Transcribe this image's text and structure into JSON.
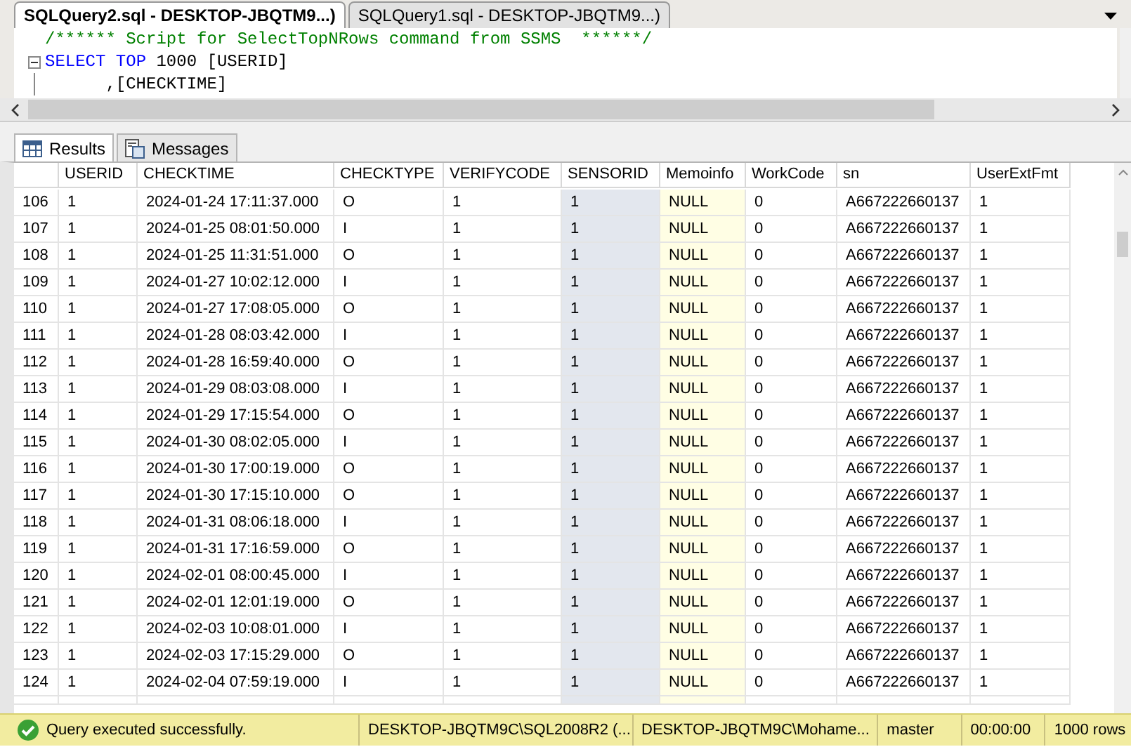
{
  "editor_tabs": [
    {
      "label": "SQLQuery2.sql - DESKTOP-JBQTM9...)",
      "selected": true
    },
    {
      "label": "SQLQuery1.sql - DESKTOP-JBQTM9...)",
      "selected": false
    }
  ],
  "editor": {
    "lines": [
      {
        "tokens": [
          {
            "kind": "comment",
            "text": "/****** Script for SelectTopNRows command from SSMS  ******/"
          }
        ]
      },
      {
        "collapsible": true,
        "tokens": [
          {
            "kind": "keyword",
            "text": "SELECT"
          },
          {
            "kind": "keyword",
            "text": " TOP"
          },
          {
            "kind": "plain",
            "text": " 1000 [USERID]"
          }
        ]
      },
      {
        "tokens": [
          {
            "kind": "plain",
            "text": "      ,[CHECKTIME]"
          }
        ]
      }
    ]
  },
  "result_tabs": [
    {
      "label": "Results",
      "selected": true
    },
    {
      "label": "Messages",
      "selected": false
    }
  ],
  "grid": {
    "columns": [
      {
        "label": "USERID",
        "kind": "text"
      },
      {
        "label": "CHECKTIME",
        "kind": "text"
      },
      {
        "label": "CHECKTYPE",
        "kind": "text"
      },
      {
        "label": "VERIFYCODE",
        "kind": "text"
      },
      {
        "label": "SENSORID",
        "kind": "highlighted"
      },
      {
        "label": "Memoinfo",
        "kind": "null"
      },
      {
        "label": "WorkCode",
        "kind": "text"
      },
      {
        "label": "sn",
        "kind": "text"
      },
      {
        "label": "UserExtFmt",
        "kind": "text"
      }
    ],
    "rows": [
      {
        "number": "106",
        "cells": [
          "1",
          "2024-01-24 17:11:37.000",
          "O",
          "1",
          "1",
          "NULL",
          "0",
          "A667222660137",
          "1"
        ]
      },
      {
        "number": "107",
        "cells": [
          "1",
          "2024-01-25 08:01:50.000",
          "I",
          "1",
          "1",
          "NULL",
          "0",
          "A667222660137",
          "1"
        ]
      },
      {
        "number": "108",
        "cells": [
          "1",
          "2024-01-25 11:31:51.000",
          "O",
          "1",
          "1",
          "NULL",
          "0",
          "A667222660137",
          "1"
        ]
      },
      {
        "number": "109",
        "cells": [
          "1",
          "2024-01-27 10:02:12.000",
          "I",
          "1",
          "1",
          "NULL",
          "0",
          "A667222660137",
          "1"
        ]
      },
      {
        "number": "110",
        "cells": [
          "1",
          "2024-01-27 17:08:05.000",
          "O",
          "1",
          "1",
          "NULL",
          "0",
          "A667222660137",
          "1"
        ]
      },
      {
        "number": "111",
        "cells": [
          "1",
          "2024-01-28 08:03:42.000",
          "I",
          "1",
          "1",
          "NULL",
          "0",
          "A667222660137",
          "1"
        ]
      },
      {
        "number": "112",
        "cells": [
          "1",
          "2024-01-28 16:59:40.000",
          "O",
          "1",
          "1",
          "NULL",
          "0",
          "A667222660137",
          "1"
        ]
      },
      {
        "number": "113",
        "cells": [
          "1",
          "2024-01-29 08:03:08.000",
          "I",
          "1",
          "1",
          "NULL",
          "0",
          "A667222660137",
          "1"
        ]
      },
      {
        "number": "114",
        "cells": [
          "1",
          "2024-01-29 17:15:54.000",
          "O",
          "1",
          "1",
          "NULL",
          "0",
          "A667222660137",
          "1"
        ]
      },
      {
        "number": "115",
        "cells": [
          "1",
          "2024-01-30 08:02:05.000",
          "I",
          "1",
          "1",
          "NULL",
          "0",
          "A667222660137",
          "1"
        ]
      },
      {
        "number": "116",
        "cells": [
          "1",
          "2024-01-30 17:00:19.000",
          "O",
          "1",
          "1",
          "NULL",
          "0",
          "A667222660137",
          "1"
        ]
      },
      {
        "number": "117",
        "cells": [
          "1",
          "2024-01-30 17:15:10.000",
          "O",
          "1",
          "1",
          "NULL",
          "0",
          "A667222660137",
          "1"
        ]
      },
      {
        "number": "118",
        "cells": [
          "1",
          "2024-01-31 08:06:18.000",
          "I",
          "1",
          "1",
          "NULL",
          "0",
          "A667222660137",
          "1"
        ]
      },
      {
        "number": "119",
        "cells": [
          "1",
          "2024-01-31 17:16:59.000",
          "O",
          "1",
          "1",
          "NULL",
          "0",
          "A667222660137",
          "1"
        ]
      },
      {
        "number": "120",
        "cells": [
          "1",
          "2024-02-01 08:00:45.000",
          "I",
          "1",
          "1",
          "NULL",
          "0",
          "A667222660137",
          "1"
        ]
      },
      {
        "number": "121",
        "cells": [
          "1",
          "2024-02-01 12:01:19.000",
          "O",
          "1",
          "1",
          "NULL",
          "0",
          "A667222660137",
          "1"
        ]
      },
      {
        "number": "122",
        "cells": [
          "1",
          "2024-02-03 10:08:01.000",
          "I",
          "1",
          "1",
          "NULL",
          "0",
          "A667222660137",
          "1"
        ]
      },
      {
        "number": "123",
        "cells": [
          "1",
          "2024-02-03 17:15:29.000",
          "O",
          "1",
          "1",
          "NULL",
          "0",
          "A667222660137",
          "1"
        ]
      },
      {
        "number": "124",
        "cells": [
          "1",
          "2024-02-04 07:59:19.000",
          "I",
          "1",
          "1",
          "NULL",
          "0",
          "A667222660137",
          "1"
        ]
      }
    ]
  },
  "status_bar": {
    "items": [
      "Query executed successfully.",
      "DESKTOP-JBQTM9C\\SQL2008R2 (...",
      "DESKTOP-JBQTM9C\\Mohame...",
      "master",
      "00:00:00",
      "1000 rows"
    ]
  }
}
